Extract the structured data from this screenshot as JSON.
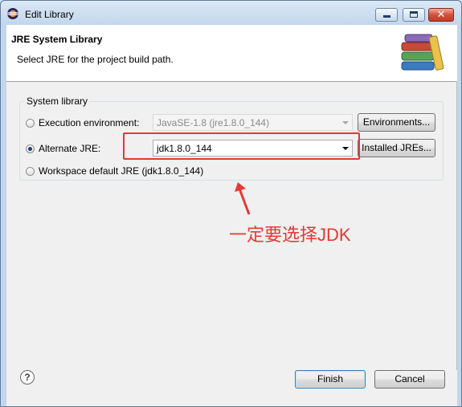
{
  "window": {
    "title": "Edit Library"
  },
  "header": {
    "title": "JRE System Library",
    "description": "Select JRE for the project build path."
  },
  "group": {
    "title": "System library",
    "execution_env": {
      "label": "Execution environment:",
      "value": "JavaSE-1.8 (jre1.8.0_144)",
      "button": "Environments...",
      "selected": false,
      "enabled": false
    },
    "alternate_jre": {
      "label": "Alternate JRE:",
      "value": "jdk1.8.0_144",
      "button": "Installed JREs...",
      "selected": true
    },
    "workspace_default": {
      "label": "Workspace default JRE (jdk1.8.0_144)",
      "selected": false
    }
  },
  "annotation": {
    "text": "一定要选择JDK",
    "color": "#e53935"
  },
  "footer": {
    "help_icon": "question-icon",
    "finish_label": "Finish",
    "cancel_label": "Cancel"
  }
}
